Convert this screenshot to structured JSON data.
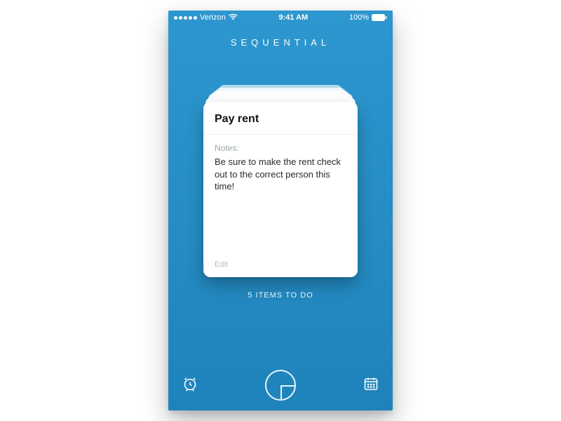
{
  "statusbar": {
    "carrier": "Verizon",
    "time": "9:41 AM",
    "battery": "100%"
  },
  "app": {
    "title": "SEQUENTIAL"
  },
  "card": {
    "title": "Pay rent",
    "notes_label": "Notes:",
    "notes_body": "Be sure to make the rent check out to the correct person this time!",
    "edit_label": "Edit"
  },
  "footer": {
    "item_count": "5 ITEMS TO DO"
  },
  "colors": {
    "bg_top": "#2d97cf",
    "bg_bottom": "#1f83bb",
    "card_bg": "#ffffff"
  }
}
